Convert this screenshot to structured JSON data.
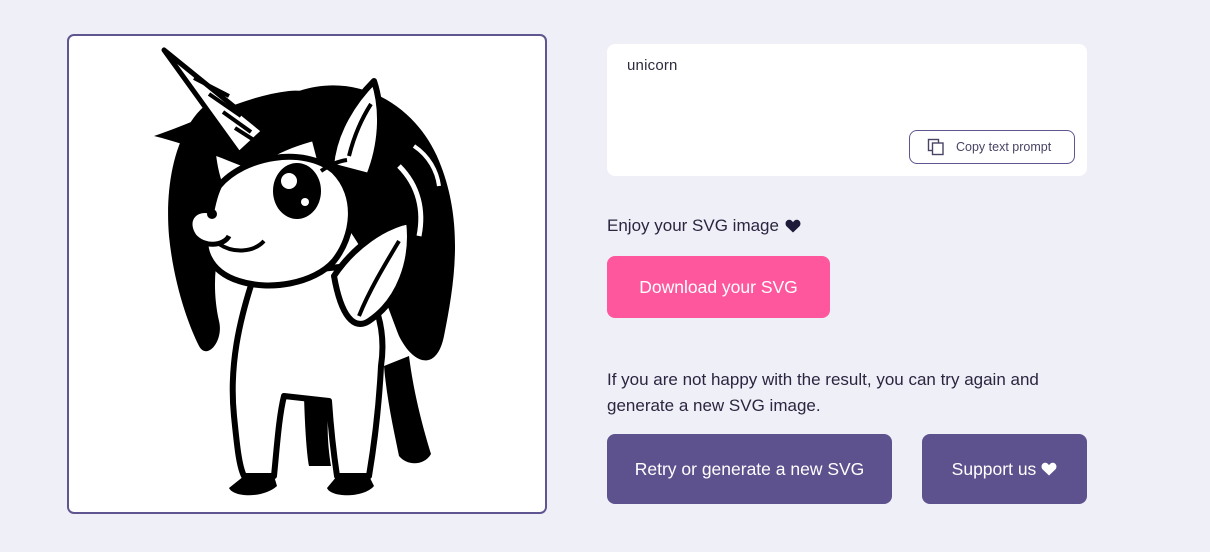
{
  "generated_image": {
    "icon": "unicorn-illustration",
    "border_color": "#5f5691"
  },
  "prompt": {
    "text": "unicorn",
    "copy_button_label": "Copy text prompt",
    "copy_icon": "copy-icon"
  },
  "result": {
    "enjoy_text": "Enjoy your SVG image",
    "enjoy_icon": "heart-icon",
    "download_label": "Download your SVG",
    "note_text": "If you are not happy with the result, you can try again and generate a new SVG image.",
    "retry_label": "Retry or generate a new SVG",
    "support_label": "Support us",
    "support_icon": "heart-icon"
  },
  "colors": {
    "page_background": "#efeff7",
    "primary_purple": "#5d528d",
    "download_pink": "#ff579e"
  }
}
